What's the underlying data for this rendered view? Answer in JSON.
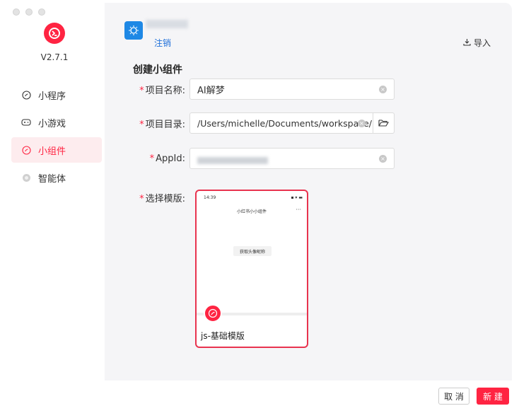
{
  "app": {
    "version": "V2.7.1"
  },
  "sidebar": {
    "items": [
      {
        "label": "小程序",
        "icon": "link-circle-icon"
      },
      {
        "label": "小游戏",
        "icon": "gamepad-icon"
      },
      {
        "label": "小组件",
        "icon": "link-circle-icon",
        "active": true
      },
      {
        "label": "智能体",
        "icon": "agent-icon"
      }
    ]
  },
  "header": {
    "logout_label": "注销",
    "import_label": "导入"
  },
  "form": {
    "title": "创建小组件",
    "name_label": "项目名称:",
    "name_value": "AI解梦",
    "dir_label": "项目目录:",
    "dir_value": "/Users/michelle/Documents/workspace/",
    "appid_label": "AppId:",
    "template_label": "选择模版:"
  },
  "template": {
    "phone_time": "14:39",
    "phone_title": "小红书小小组件",
    "phone_button": "获取头像昵称",
    "name": "js-基础模版"
  },
  "footer": {
    "cancel_label": "取 消",
    "create_label": "新 建"
  },
  "colors": {
    "accent": "#ff2442",
    "link": "#1e6fd9"
  }
}
